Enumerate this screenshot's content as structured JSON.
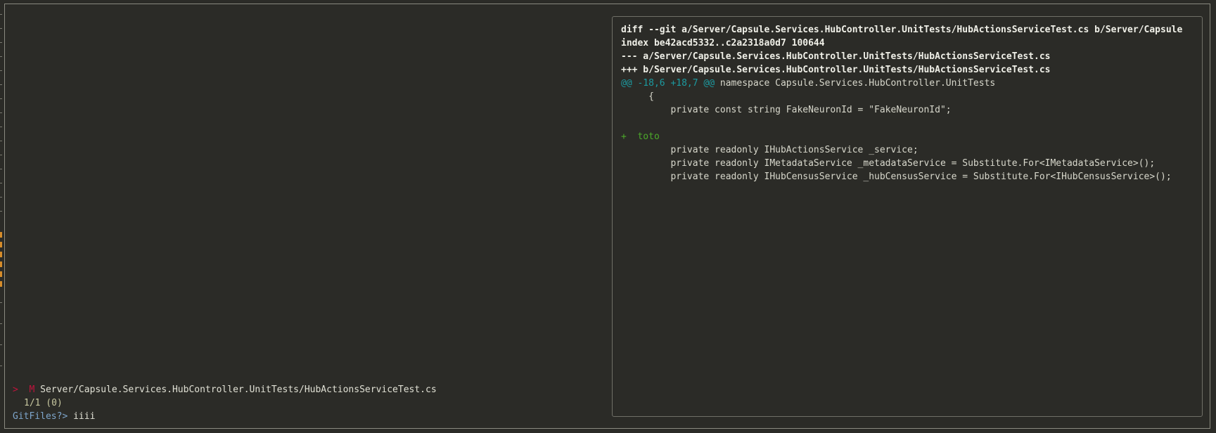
{
  "preview": {
    "lines": [
      {
        "text": "diff --git a/Server/Capsule.Services.HubController.UnitTests/HubActionsServiceTest.cs b/Server/Capsule",
        "kind": "bold"
      },
      {
        "text": "index be42acd5332..c2a2318a0d7 100644",
        "kind": "bold"
      },
      {
        "text": "--- a/Server/Capsule.Services.HubController.UnitTests/HubActionsServiceTest.cs",
        "kind": "bold"
      },
      {
        "text": "+++ b/Server/Capsule.Services.HubController.UnitTests/HubActionsServiceTest.cs",
        "kind": "bold"
      },
      {
        "hunk": "@@ -18,6 +18,7 @@",
        "rest": " namespace Capsule.Services.HubController.UnitTests",
        "kind": "hunk"
      },
      {
        "text": "     {",
        "kind": "ctx"
      },
      {
        "text": "         private const string FakeNeuronId = \"FakeNeuronId\";",
        "kind": "ctx"
      },
      {
        "text": "",
        "kind": "ctx"
      },
      {
        "text": "+  toto",
        "kind": "added"
      },
      {
        "text": "         private readonly IHubActionsService _service;",
        "kind": "ctx"
      },
      {
        "text": "         private readonly IMetadataService _metadataService = Substitute.For<IMetadataService>();",
        "kind": "ctx"
      },
      {
        "text": "         private readonly IHubCensusService _hubCensusService = Substitute.For<IHubCensusService>();",
        "kind": "ctx"
      }
    ]
  },
  "results": {
    "pointer": ">",
    "status": "M",
    "path": "Server/Capsule.Services.HubController.UnitTests/HubActionsServiceTest.cs",
    "counter": "1/1 (0)"
  },
  "prompt": {
    "label": "GitFiles?>",
    "query": "iiii"
  },
  "colors": {
    "background": "#2b2b27",
    "hunk": "#1c9aa0",
    "added": "#4caa2a",
    "pointer": "#c0143c",
    "prompt": "#7ea6cc"
  }
}
